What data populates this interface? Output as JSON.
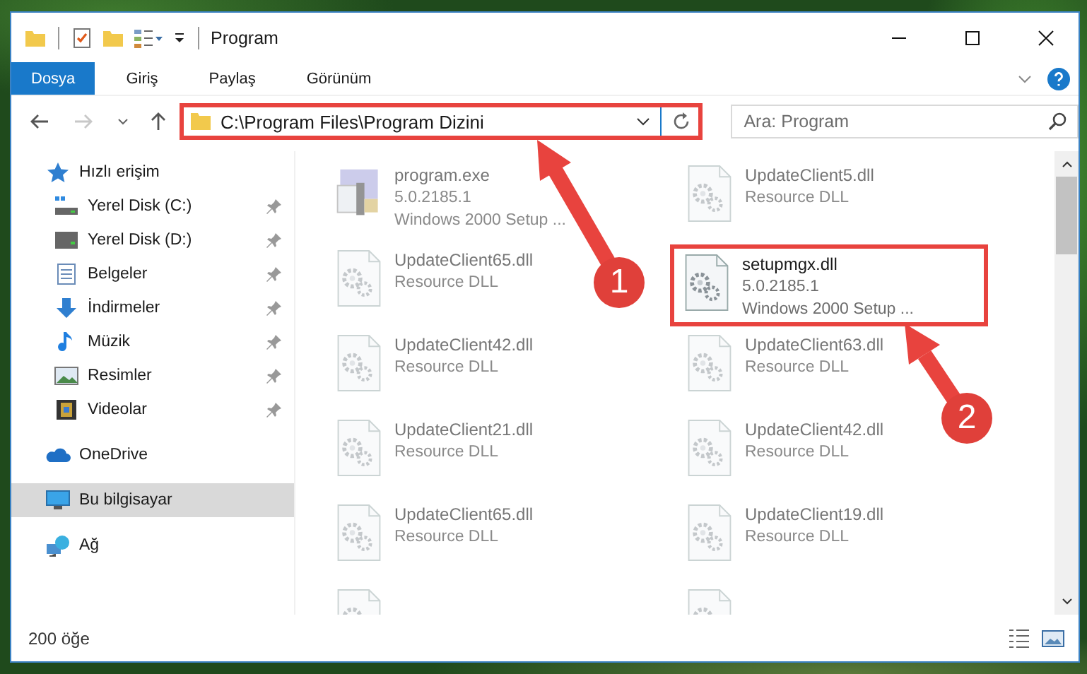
{
  "window": {
    "title": "Program"
  },
  "ribbon_tabs": [
    {
      "label": "Dosya",
      "selected": true
    },
    {
      "label": "Giriş",
      "selected": false
    },
    {
      "label": "Paylaş",
      "selected": false
    },
    {
      "label": "Görünüm",
      "selected": false
    }
  ],
  "address": {
    "path": "C:\\Program Files\\Program Dizini",
    "highlighted": true
  },
  "search": {
    "placeholder": "Ara: Program"
  },
  "sidebar": {
    "items": [
      {
        "label": "Hızlı erişim",
        "kind": "star",
        "selected": false,
        "children": [
          {
            "label": "Yerel Disk (C:)",
            "kind": "system-drive",
            "pinned": true
          },
          {
            "label": "Yerel Disk (D:)",
            "kind": "drive",
            "pinned": true
          },
          {
            "label": "Belgeler",
            "kind": "documents",
            "pinned": true
          },
          {
            "label": "İndirmeler",
            "kind": "download",
            "pinned": true
          },
          {
            "label": "Müzik",
            "kind": "music",
            "pinned": true
          },
          {
            "label": "Resimler",
            "kind": "pictures",
            "pinned": true
          },
          {
            "label": "Videolar",
            "kind": "videos",
            "pinned": true
          }
        ]
      },
      {
        "label": "OneDrive",
        "kind": "cloud",
        "selected": false
      },
      {
        "label": "Bu bilgisayar",
        "kind": "computer",
        "selected": true
      },
      {
        "label": "Ağ",
        "kind": "network",
        "selected": false
      }
    ]
  },
  "files": [
    {
      "name": "program.exe",
      "details": [
        "5.0.2185.1",
        "Windows 2000 Setup ..."
      ],
      "kind": "exe",
      "blurred": true,
      "highlighted": false
    },
    {
      "name": "UpdateClient5.dll",
      "details": [
        "Resource DLL"
      ],
      "kind": "dll",
      "blurred": true,
      "highlighted": false
    },
    {
      "name": "UpdateClient65.dll",
      "details": [
        "Resource DLL"
      ],
      "kind": "dll",
      "blurred": true,
      "highlighted": false
    },
    {
      "name": "setupmgx.dll",
      "details": [
        "5.0.2185.1",
        "Windows 2000 Setup ..."
      ],
      "kind": "dll",
      "blurred": false,
      "highlighted": true
    },
    {
      "name": "UpdateClient42.dll",
      "details": [
        "Resource DLL"
      ],
      "kind": "dll",
      "blurred": true,
      "highlighted": false
    },
    {
      "name": "UpdateClient63.dll",
      "details": [
        "Resource DLL"
      ],
      "kind": "dll",
      "blurred": true,
      "highlighted": false
    },
    {
      "name": "UpdateClient21.dll",
      "details": [
        "Resource DLL"
      ],
      "kind": "dll",
      "blurred": true,
      "highlighted": false
    },
    {
      "name": "UpdateClient42.dll",
      "details": [
        "Resource DLL"
      ],
      "kind": "dll",
      "blurred": true,
      "highlighted": false
    },
    {
      "name": "UpdateClient65.dll",
      "details": [
        "Resource DLL"
      ],
      "kind": "dll",
      "blurred": true,
      "highlighted": false
    },
    {
      "name": "UpdateClient19.dll",
      "details": [
        "Resource DLL"
      ],
      "kind": "dll",
      "blurred": true,
      "highlighted": false
    },
    {
      "kind": "dll",
      "blurred": true,
      "highlighted": false
    },
    {
      "kind": "dll",
      "blurred": true,
      "highlighted": false
    }
  ],
  "status_bar": {
    "item_count": "200 öğe"
  },
  "annotations": [
    {
      "label": "1"
    },
    {
      "label": "2"
    }
  ]
}
